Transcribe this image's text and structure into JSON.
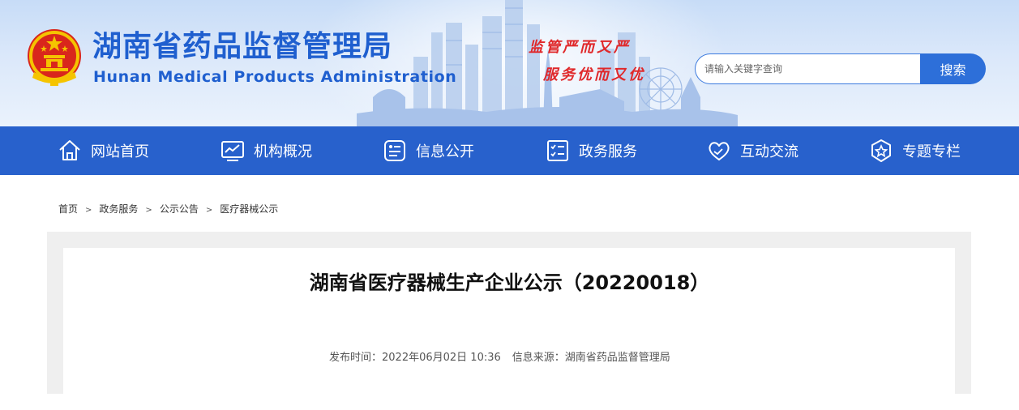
{
  "header": {
    "title": "湖南省药品监督管理局",
    "subtitle": "Hunan Medical Products Administration",
    "slogan_line1": "监管严而又严",
    "slogan_line2": "服务优而又优",
    "search_placeholder": "请输入关键字查询",
    "search_button": "搜索"
  },
  "nav": {
    "items": [
      {
        "label": "网站首页",
        "icon": "home-icon"
      },
      {
        "label": "机构概况",
        "icon": "chart-screen-icon"
      },
      {
        "label": "信息公开",
        "icon": "info-card-icon"
      },
      {
        "label": "政务服务",
        "icon": "checklist-icon"
      },
      {
        "label": "互动交流",
        "icon": "heart-hand-icon"
      },
      {
        "label": "专题专栏",
        "icon": "star-badge-icon"
      }
    ]
  },
  "breadcrumb": [
    "首页",
    "政务服务",
    "公示公告",
    "医疗器械公示"
  ],
  "breadcrumb_separator": ">",
  "article": {
    "title": "湖南省医疗器械生产企业公示（20220018）",
    "publish_time": "发布时间：2022年06月02日 10:36",
    "source": "信息来源：湖南省药品监督管理局"
  },
  "colors": {
    "brand_blue": "#2861cc",
    "title_blue": "#1f5fcf",
    "slogan_red": "#e0282a"
  }
}
